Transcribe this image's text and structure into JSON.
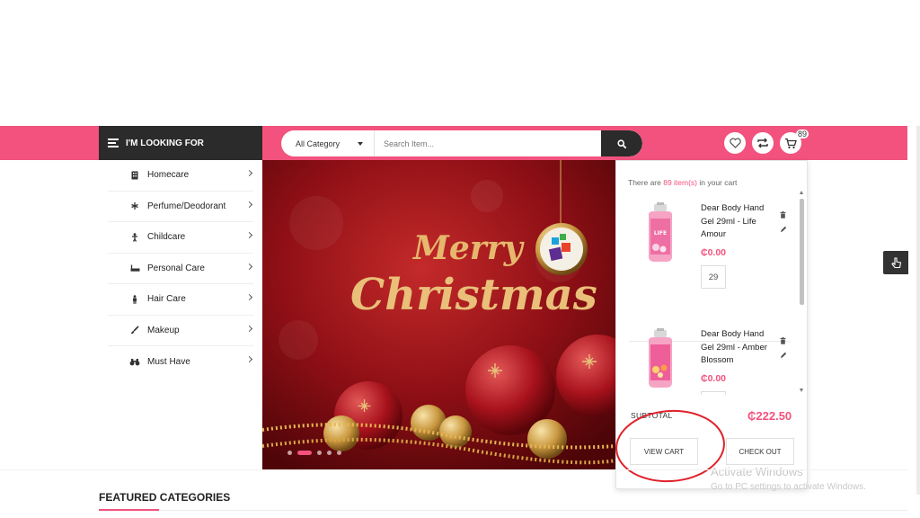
{
  "header": {
    "looking_label": "I'M LOOKING FOR",
    "category_select": "All Category",
    "search_placeholder": "Search Item...",
    "cart_count": "89"
  },
  "sidebar": {
    "items": [
      {
        "label": "Homecare",
        "icon": "building-icon"
      },
      {
        "label": "Perfume/Deodorant",
        "icon": "flower-icon"
      },
      {
        "label": "Childcare",
        "icon": "child-icon"
      },
      {
        "label": "Personal Care",
        "icon": "bathtub-icon"
      },
      {
        "label": "Hair Care",
        "icon": "person-icon"
      },
      {
        "label": "Makeup",
        "icon": "brush-icon"
      },
      {
        "label": "Must Have",
        "icon": "binoculars-icon"
      }
    ]
  },
  "banner": {
    "line1": "Merry",
    "line2": "Christmas",
    "slide_count": 5,
    "active_slide": 1
  },
  "cart": {
    "msg_prefix": "There are ",
    "msg_count": "89 item(s)",
    "msg_suffix": " in your cart",
    "items": [
      {
        "name": "Dear Body Hand Gel 29ml - Life Amour",
        "price": "₵0.00",
        "qty": "29",
        "label": "LIFE"
      },
      {
        "name": "Dear Body Hand Gel 29ml - Amber Blossom",
        "price": "₵0.00",
        "qty": ""
      }
    ],
    "subtotal_label": "SUBTOTAL",
    "subtotal_value": "₵222.50",
    "view_cart": "VIEW CART",
    "checkout": "CHECK OUT"
  },
  "windows_notice": {
    "title": "Activate Windows",
    "subtitle": "Go to PC settings to activate Windows."
  },
  "featured": {
    "title": "FEATURED CATEGORIES"
  },
  "colors": {
    "brand_pink": "#f2527d",
    "dark": "#2b2b2b",
    "annotation_red": "#e0212a"
  }
}
